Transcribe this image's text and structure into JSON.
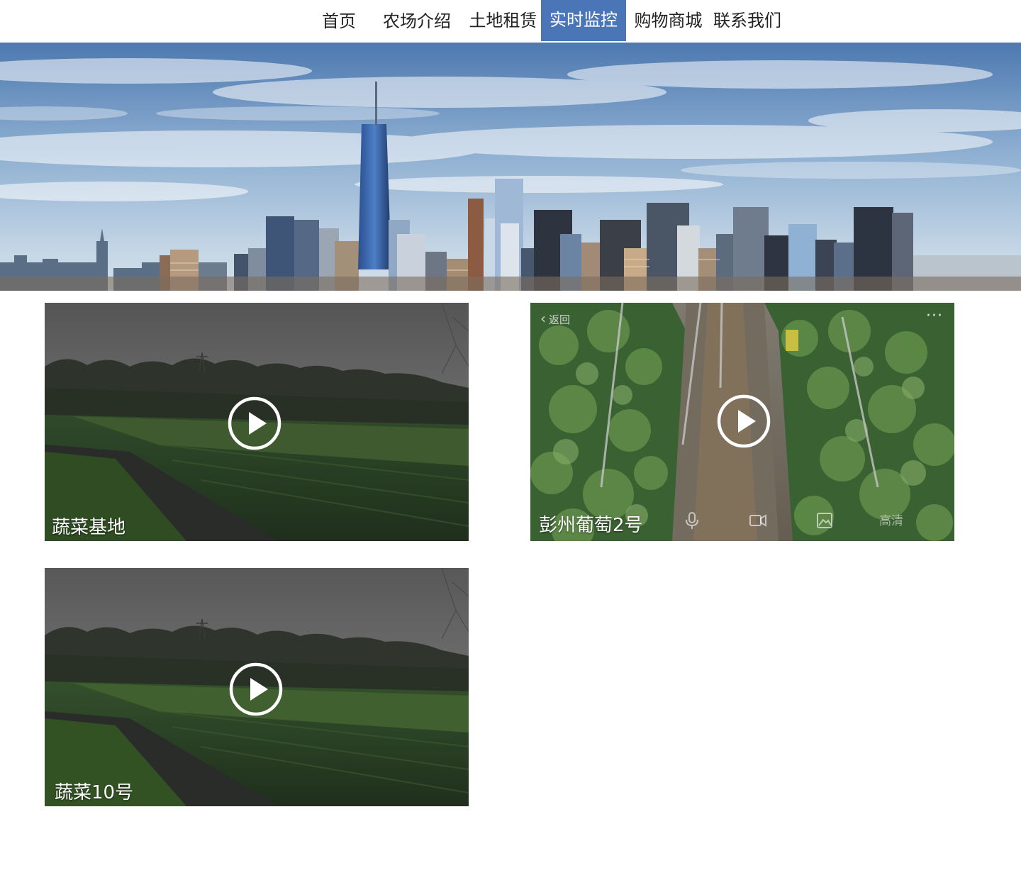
{
  "nav": {
    "items": [
      {
        "label": "首页"
      },
      {
        "label": "农场介绍"
      },
      {
        "label": "土地租赁"
      },
      {
        "label": "实时监控"
      },
      {
        "label": "购物商城"
      },
      {
        "label": "联系我们"
      }
    ],
    "active_index": 3,
    "active_color": "#4a76b8"
  },
  "banner": {
    "image": "city-skyline-photo"
  },
  "cameras": [
    {
      "title": "蔬菜基地",
      "icon": "play-icon"
    },
    {
      "title": "彭州葡萄2号",
      "icon": "play-icon",
      "overlay": {
        "back_label": "返回",
        "more": "···",
        "quality_label": "高清"
      }
    },
    {
      "title": "蔬菜10号",
      "icon": "play-icon"
    }
  ]
}
